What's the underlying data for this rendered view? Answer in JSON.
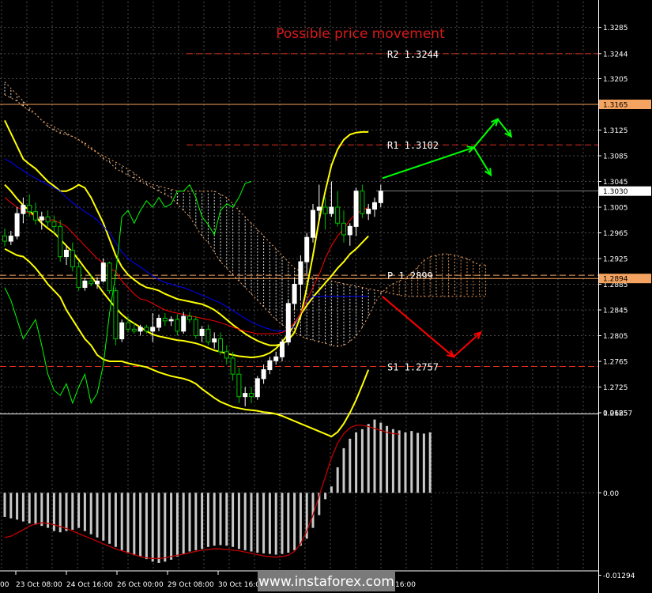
{
  "watermark": "www.instaforex.com",
  "chart_data": [
    {
      "type": "candlestick",
      "title": "Possible price movement",
      "ylim": [
        1.2685,
        1.3325
      ],
      "y_ticks": [
        "1.3285",
        "1.3244",
        "1.3205",
        "1.3165",
        "1.3125",
        "1.3085",
        "1.3045",
        "1.3005",
        "1.2965",
        "1.2925",
        "1.2885",
        "1.2845",
        "1.2805",
        "1.2765",
        "1.2725",
        "1.2685"
      ],
      "x_tick_labels": [
        "23 Oct 08:00",
        "24 Oct 16:00",
        "26 Oct 00:00",
        "29 Oct 08:00",
        "30 Oct 16:00"
      ],
      "x_edge_labels": [
        "00",
        "16:00"
      ],
      "current_price": {
        "value": 1.303,
        "label": "1.3030",
        "color": "#ffffff"
      },
      "highlighted_levels": [
        {
          "value": 1.3165,
          "label": "1.3165",
          "color": "#f4a460"
        },
        {
          "value": 1.2894,
          "label": "1.2894",
          "color": "#f4a460"
        }
      ],
      "pivot_levels": [
        {
          "name": "R2",
          "label": "R2 1.3244",
          "value": 1.3244,
          "color": "#e0301e"
        },
        {
          "name": "R1",
          "label": "R1 1.3102",
          "value": 1.3102,
          "color": "#e0301e"
        },
        {
          "name": "P",
          "label": "P 1.2899",
          "value": 1.2899,
          "color": "#f4a460"
        },
        {
          "name": "S1",
          "label": "S1 1.2757",
          "value": 1.2757,
          "color": "#e0301e"
        }
      ],
      "colors": {
        "bull": "#ffffff",
        "bear": "#00c000",
        "bollinger": "#ffff00",
        "kijun": "#0000ff",
        "tenkan": "#ff0000",
        "chikou": "#00ff00",
        "cloud": "#ffffff",
        "cloud_alt": "#f4a460",
        "arrow_up": "#00ff00",
        "arrow_down": "#ff0000"
      },
      "candles": [
        [
          1.296,
          1.2972,
          1.2944,
          1.2952
        ],
        [
          1.2952,
          1.2968,
          1.2946,
          1.296
        ],
        [
          1.296,
          1.3005,
          1.2955,
          1.2995
        ],
        [
          1.2995,
          1.302,
          1.298,
          1.3008
        ],
        [
          1.3008,
          1.3025,
          1.299,
          1.2998
        ],
        [
          1.2998,
          1.3012,
          1.2978,
          1.2985
        ],
        [
          1.2985,
          1.2998,
          1.297,
          1.299
        ],
        [
          1.299,
          1.3,
          1.2975,
          1.2982
        ],
        [
          1.2982,
          1.2992,
          1.2965,
          1.2975
        ],
        [
          1.2975,
          1.2985,
          1.292,
          1.2928
        ],
        [
          1.2928,
          1.2945,
          1.2915,
          1.2938
        ],
        [
          1.2938,
          1.295,
          1.2905,
          1.2912
        ],
        [
          1.2912,
          1.292,
          1.2875,
          1.288
        ],
        [
          1.288,
          1.2895,
          1.2875,
          1.289
        ],
        [
          1.289,
          1.29,
          1.2882,
          1.2886
        ],
        [
          1.2886,
          1.2896,
          1.2878,
          1.289
        ],
        [
          1.289,
          1.2925,
          1.2888,
          1.2918
        ],
        [
          1.2918,
          1.292,
          1.287,
          1.2875
        ],
        [
          1.2875,
          1.288,
          1.279,
          1.28
        ],
        [
          1.28,
          1.283,
          1.2795,
          1.2825
        ],
        [
          1.2825,
          1.2835,
          1.281,
          1.2815
        ],
        [
          1.2815,
          1.2825,
          1.2808,
          1.2812
        ],
        [
          1.2812,
          1.2822,
          1.2805,
          1.2818
        ],
        [
          1.2818,
          1.2822,
          1.2808,
          1.2812
        ],
        [
          1.2812,
          1.284,
          1.2795,
          1.2818
        ],
        [
          1.2818,
          1.2838,
          1.2812,
          1.2832
        ],
        [
          1.2832,
          1.284,
          1.282,
          1.2828
        ],
        [
          1.2828,
          1.2835,
          1.282,
          1.283
        ],
        [
          1.283,
          1.2838,
          1.2805,
          1.2812
        ],
        [
          1.2812,
          1.2842,
          1.2808,
          1.2835
        ],
        [
          1.2835,
          1.2842,
          1.2825,
          1.283
        ],
        [
          1.283,
          1.2835,
          1.28,
          1.2805
        ],
        [
          1.2805,
          1.282,
          1.2795,
          1.2815
        ],
        [
          1.2815,
          1.2822,
          1.279,
          1.2795
        ],
        [
          1.2795,
          1.281,
          1.2785,
          1.28
        ],
        [
          1.28,
          1.281,
          1.2775,
          1.278
        ],
        [
          1.278,
          1.279,
          1.276,
          1.277
        ],
        [
          1.277,
          1.278,
          1.2735,
          1.2745
        ],
        [
          1.2745,
          1.2755,
          1.27,
          1.271
        ],
        [
          1.271,
          1.2725,
          1.2695,
          1.2715
        ],
        [
          1.2715,
          1.2725,
          1.27,
          1.271
        ],
        [
          1.271,
          1.2742,
          1.2705,
          1.2738
        ],
        [
          1.2738,
          1.276,
          1.273,
          1.2752
        ],
        [
          1.2752,
          1.2772,
          1.2745,
          1.2766
        ],
        [
          1.2766,
          1.278,
          1.276,
          1.2772
        ],
        [
          1.2772,
          1.28,
          1.2765,
          1.2795
        ],
        [
          1.2795,
          1.2862,
          1.279,
          1.2855
        ],
        [
          1.2855,
          1.2895,
          1.2845,
          1.2885
        ],
        [
          1.2885,
          1.293,
          1.286,
          1.292
        ],
        [
          1.292,
          1.2965,
          1.29,
          1.2958
        ],
        [
          1.2958,
          1.301,
          1.295,
          1.3
        ],
        [
          1.3,
          1.304,
          1.2985,
          1.3005
        ],
        [
          1.3005,
          1.302,
          1.297,
          1.2995
        ],
        [
          1.2995,
          1.3045,
          1.299,
          1.3005
        ],
        [
          1.3005,
          1.303,
          1.2975,
          1.298
        ],
        [
          1.298,
          1.3,
          1.295,
          1.2962
        ],
        [
          1.2962,
          1.298,
          1.2945,
          1.2975
        ],
        [
          1.2975,
          1.3035,
          1.296,
          1.303
        ],
        [
          1.303,
          1.304,
          1.2988,
          1.2995
        ],
        [
          1.2995,
          1.301,
          1.2985,
          1.3002
        ],
        [
          1.3002,
          1.302,
          1.299,
          1.3012
        ],
        [
          1.3012,
          1.304,
          1.3005,
          1.303
        ]
      ],
      "bollinger_upper": [
        1.314,
        1.312,
        1.31,
        1.308,
        1.3072,
        1.3065,
        1.3055,
        1.3045,
        1.3038,
        1.303,
        1.303,
        1.3034,
        1.304,
        1.3035,
        1.302,
        1.3,
        1.298,
        1.2955,
        1.293,
        1.2912,
        1.29,
        1.2892,
        1.2885,
        1.288,
        1.2878,
        1.2875,
        1.287,
        1.2866,
        1.2862,
        1.286,
        1.2858,
        1.2856,
        1.2854,
        1.285,
        1.2845,
        1.2838,
        1.283,
        1.2822,
        1.2815,
        1.2808,
        1.2802,
        1.2797,
        1.2793,
        1.279,
        1.279,
        1.2792,
        1.2798,
        1.281,
        1.2835,
        1.288,
        1.293,
        1.2985,
        1.303,
        1.307,
        1.3095,
        1.311,
        1.3118,
        1.3121,
        1.3122,
        1.3122
      ],
      "bollinger_middle": [
        1.304,
        1.303,
        1.3018,
        1.3008,
        1.3,
        1.299,
        1.298,
        1.2972,
        1.2965,
        1.2955,
        1.2945,
        1.2935,
        1.2923,
        1.291,
        1.2898,
        1.2885,
        1.2872,
        1.286,
        1.2848,
        1.2838,
        1.283,
        1.2824,
        1.2818,
        1.2812,
        1.2807,
        1.2804,
        1.2802,
        1.28,
        1.2798,
        1.2797,
        1.2795,
        1.2793,
        1.279,
        1.2786,
        1.2782,
        1.278,
        1.2777,
        1.2775,
        1.2773,
        1.2772,
        1.2771,
        1.2772,
        1.2774,
        1.2778,
        1.2785,
        1.2795,
        1.2808,
        1.2822,
        1.2838,
        1.2852,
        1.2865,
        1.2876,
        1.2887,
        1.2898,
        1.291,
        1.292,
        1.2932,
        1.294,
        1.295,
        1.296
      ],
      "bollinger_lower": [
        1.294,
        1.2935,
        1.293,
        1.2928,
        1.292,
        1.291,
        1.2898,
        1.2885,
        1.2875,
        1.2865,
        1.2845,
        1.283,
        1.2815,
        1.28,
        1.279,
        1.2775,
        1.2768,
        1.2765,
        1.2765,
        1.2765,
        1.2762,
        1.276,
        1.2758,
        1.2756,
        1.2752,
        1.2748,
        1.2745,
        1.2742,
        1.274,
        1.2738,
        1.2735,
        1.273,
        1.2722,
        1.2715,
        1.2708,
        1.2702,
        1.2698,
        1.2694,
        1.2692,
        1.269,
        1.2689,
        1.2688,
        1.2686,
        1.2685,
        1.2683,
        1.268,
        1.2676,
        1.2672,
        1.2668,
        1.2664,
        1.266,
        1.2656,
        1.2652,
        1.2648,
        1.2655,
        1.2668,
        1.2685,
        1.2705,
        1.2728,
        1.2752
      ],
      "tenkan": [
        1.302,
        1.3012,
        1.3005,
        1.3,
        1.2995,
        1.299,
        1.2988,
        1.2985,
        1.2985,
        1.298,
        1.2975,
        1.2965,
        1.2955,
        1.2945,
        1.2935,
        1.2925,
        1.2918,
        1.291,
        1.2905,
        1.289,
        1.288,
        1.287,
        1.2862,
        1.286,
        1.2855,
        1.285,
        1.2845,
        1.2842,
        1.284,
        1.2838,
        1.2836,
        1.2834,
        1.2832,
        1.283,
        1.2828,
        1.2825,
        1.2822,
        1.2818,
        1.2815,
        1.2812,
        1.281,
        1.2808,
        1.2808,
        1.2808,
        1.2808,
        1.281,
        1.2815,
        1.2825,
        1.284,
        1.286,
        1.288,
        1.29,
        1.2925,
        1.2945,
        1.296,
        1.2972,
        1.2985,
        1.2995,
        1.3,
        1.3005
      ],
      "kijun": [
        1.308,
        1.3075,
        1.3068,
        1.3062,
        1.3055,
        1.305,
        1.3045,
        1.304,
        1.3035,
        1.303,
        1.302,
        1.3012,
        1.3005,
        1.2998,
        1.2992,
        1.2985,
        1.2975,
        1.2965,
        1.295,
        1.2935,
        1.2925,
        1.2918,
        1.2912,
        1.2905,
        1.2898,
        1.2892,
        1.2888,
        1.2885,
        1.2882,
        1.288,
        1.2876,
        1.2872,
        1.2868,
        1.2864,
        1.286,
        1.2856,
        1.285,
        1.2844,
        1.2838,
        1.2832,
        1.2826,
        1.2822,
        1.2818,
        1.2815,
        1.2812,
        1.2812,
        1.2814,
        1.282,
        1.284,
        1.2858,
        1.2866,
        1.2866,
        1.2866,
        1.2866,
        1.2866,
        1.2866,
        1.2866,
        1.2866,
        1.2866,
        1.2866
      ],
      "chikou": [
        1.288,
        1.286,
        1.283,
        1.28,
        1.2815,
        1.283,
        1.279,
        1.2745,
        1.272,
        1.2712,
        1.273,
        1.27,
        1.2725,
        1.2745,
        1.27,
        1.2715,
        1.276,
        1.284,
        1.29,
        1.299,
        1.3,
        1.298,
        1.3,
        1.3015,
        1.3005,
        1.302,
        1.3005,
        1.301,
        1.303,
        1.303,
        1.304,
        1.302,
        1.299,
        1.2978,
        1.2962,
        1.3,
        1.301,
        1.3005,
        1.302,
        1.3042,
        1.3045
      ],
      "span_a": [
        1.318,
        1.3175,
        1.317,
        1.3162,
        1.3155,
        1.315,
        1.314,
        1.313,
        1.3125,
        1.312,
        1.3118,
        1.3115,
        1.311,
        1.3105,
        1.3098,
        1.309,
        1.308,
        1.3075,
        1.3065,
        1.306,
        1.3055,
        1.305,
        1.3045,
        1.304,
        1.3035,
        1.303,
        1.3025,
        1.302,
        1.301,
        1.3,
        1.299,
        1.2975,
        1.296,
        1.295,
        1.2935,
        1.292,
        1.291,
        1.29,
        1.289,
        1.288,
        1.287,
        1.286,
        1.285,
        1.284,
        1.283,
        1.2822,
        1.2815,
        1.281,
        1.2805,
        1.28,
        1.2798,
        1.2795,
        1.2793,
        1.279,
        1.2788,
        1.279,
        1.2796,
        1.2805,
        1.2818,
        1.2835,
        1.2855,
        1.287,
        1.288,
        1.2886,
        1.289,
        1.2895,
        1.2902,
        1.2912,
        1.2922,
        1.2928,
        1.293,
        1.2932,
        1.2932,
        1.293,
        1.2928,
        1.2925,
        1.292,
        1.2915,
        1.2915
      ],
      "span_b": [
        1.32,
        1.319,
        1.318,
        1.317,
        1.316,
        1.315,
        1.314,
        1.3135,
        1.313,
        1.3125,
        1.312,
        1.3115,
        1.311,
        1.3102,
        1.3095,
        1.309,
        1.3085,
        1.308,
        1.3075,
        1.307,
        1.3064,
        1.3058,
        1.305,
        1.3044,
        1.304,
        1.3038,
        1.3035,
        1.3033,
        1.303,
        1.303,
        1.303,
        1.303,
        1.303,
        1.303,
        1.303,
        1.3025,
        1.302,
        1.301,
        1.3,
        1.299,
        1.298,
        1.297,
        1.296,
        1.295,
        1.294,
        1.293,
        1.292,
        1.291,
        1.2905,
        1.29,
        1.2896,
        1.2894,
        1.2892,
        1.289,
        1.2888,
        1.2886,
        1.2884,
        1.2882,
        1.288,
        1.2878,
        1.2876,
        1.2874,
        1.2872,
        1.287,
        1.2868,
        1.2866,
        1.2866,
        1.2866,
        1.2866,
        1.2866,
        1.2866,
        1.2866,
        1.2866,
        1.2866,
        1.2866,
        1.2866,
        1.2866,
        1.2866,
        1.2866
      ],
      "arrows": [
        {
          "color": "#00ff00",
          "points": [
            [
              1.305,
              -1
            ],
            [
              1.3098,
              26
            ],
            [
              1.3055,
              31
            ]
          ]
        },
        {
          "color": "#00ff00",
          "points": [
            [
              1.3098,
              26
            ],
            [
              1.3142,
              33
            ],
            [
              1.3115,
              37
            ]
          ]
        },
        {
          "color": "#ff0000",
          "points": [
            [
              1.2866,
              -1
            ],
            [
              1.2772,
              20
            ],
            [
              1.281,
              28
            ]
          ]
        }
      ]
    },
    {
      "type": "bar",
      "indicator": "oscillator",
      "ylim": [
        -0.012,
        0.0122
      ],
      "y_ticks": [
        "0.01257",
        "0.00",
        "-0.01294"
      ],
      "values": [
        -0.0038,
        -0.004,
        -0.0042,
        -0.0045,
        -0.0048,
        -0.005,
        -0.0052,
        -0.0055,
        -0.006,
        -0.0062,
        -0.006,
        -0.0058,
        -0.0055,
        -0.006,
        -0.0065,
        -0.007,
        -0.0075,
        -0.008,
        -0.0085,
        -0.009,
        -0.0095,
        -0.0098,
        -0.01,
        -0.0104,
        -0.0108,
        -0.011,
        -0.0108,
        -0.0105,
        -0.01,
        -0.0096,
        -0.0092,
        -0.009,
        -0.0088,
        -0.0085,
        -0.0083,
        -0.0082,
        -0.0083,
        -0.0085,
        -0.0088,
        -0.009,
        -0.0092,
        -0.0094,
        -0.0095,
        -0.0096,
        -0.0097,
        -0.0096,
        -0.0094,
        -0.009,
        -0.0083,
        -0.0072,
        -0.0055,
        -0.0035,
        -0.001,
        0.001,
        0.004,
        0.007,
        0.0085,
        0.0095,
        0.01,
        0.0108,
        0.0115,
        0.011,
        0.0105,
        0.01,
        0.0098,
        0.0095,
        0.0097,
        0.0094,
        0.0093,
        0.0095
      ],
      "signal": [
        -0.007,
        -0.0068,
        -0.0063,
        -0.0058,
        -0.0052,
        -0.0049,
        -0.0047,
        -0.0048,
        -0.005,
        -0.0053,
        -0.0056,
        -0.006,
        -0.0064,
        -0.0068,
        -0.0072,
        -0.0076,
        -0.008,
        -0.0084,
        -0.0088,
        -0.0091,
        -0.0094,
        -0.0097,
        -0.01,
        -0.0102,
        -0.0103,
        -0.0103,
        -0.0102,
        -0.01,
        -0.0098,
        -0.0096,
        -0.0094,
        -0.0092,
        -0.009,
        -0.0089,
        -0.0088,
        -0.0088,
        -0.0089,
        -0.009,
        -0.0091,
        -0.0093,
        -0.0095,
        -0.0097,
        -0.0099,
        -0.01,
        -0.0101,
        -0.01,
        -0.0098,
        -0.0092,
        -0.008,
        -0.006,
        -0.0035,
        -0.0005,
        0.0025,
        0.0055,
        0.0078,
        0.0093,
        0.0102,
        0.0106,
        0.0106,
        0.0104,
        0.0101,
        0.0098,
        0.0095,
        0.0093,
        0.0092
      ]
    }
  ]
}
